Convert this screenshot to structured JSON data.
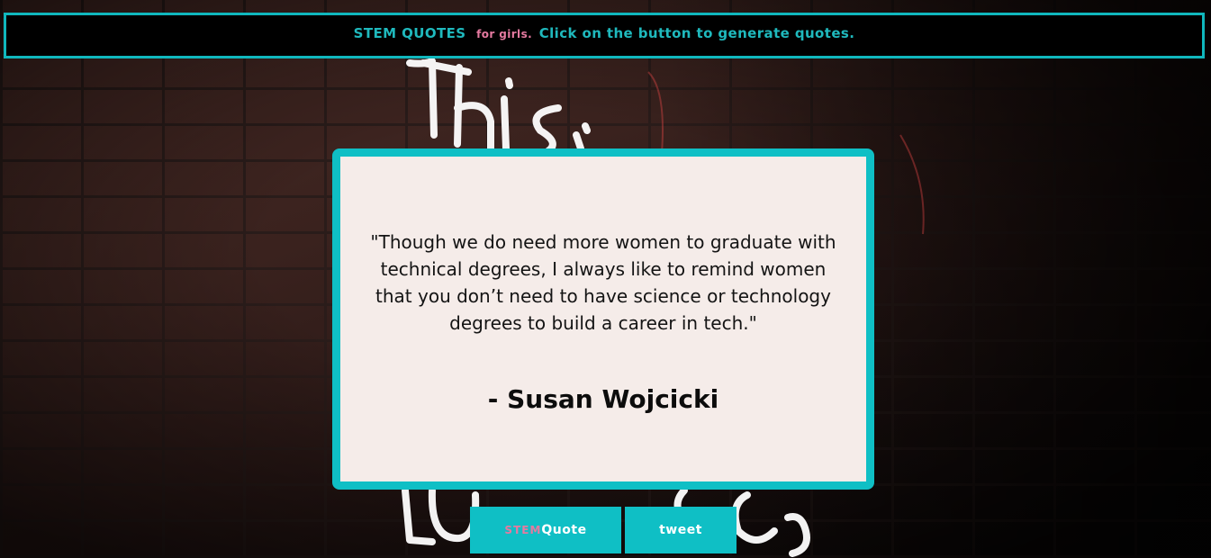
{
  "banner": {
    "title": "STEM QUOTES",
    "subtitle": "for girls.",
    "instruction": "Click on the button to generate quotes."
  },
  "quote": {
    "text": "\"Though we do need more women to graduate with technical degrees, I always like to remind women that you don’t need to have science or technology degrees to build a career in tech.\"",
    "author": "- Susan Wojcicki"
  },
  "buttons": {
    "quote_prefix": "STEM",
    "quote_label": "Quote",
    "tweet_label": "tweet"
  },
  "colors": {
    "accent": "#0fbfc5",
    "pink": "#e57aa0",
    "card_bg": "#f5ece9"
  }
}
